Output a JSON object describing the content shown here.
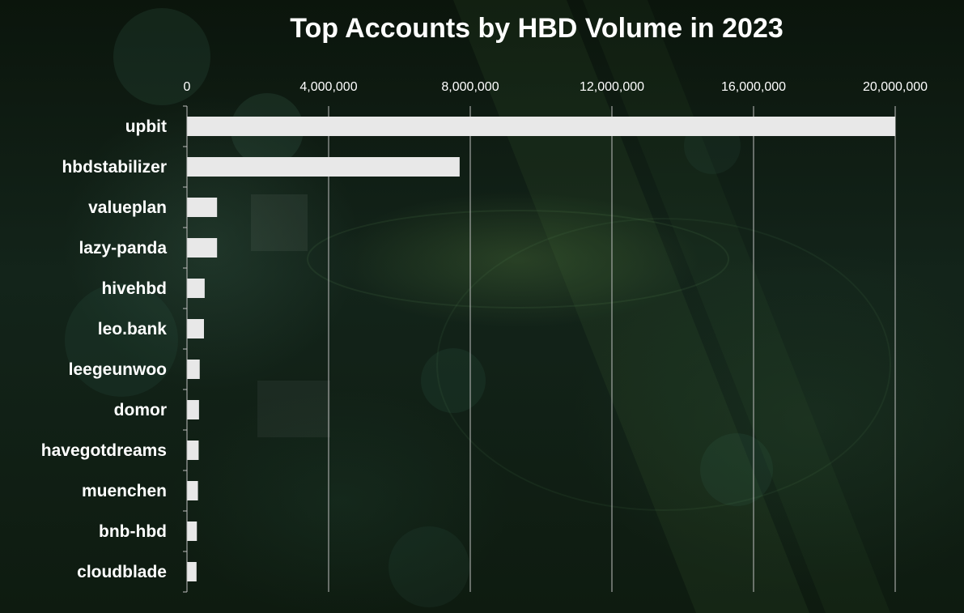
{
  "chart_data": {
    "type": "bar",
    "orientation": "horizontal",
    "title": "Top Accounts by HBD Volume in 2023",
    "xlabel": "",
    "ylabel": "",
    "xlim": [
      0,
      20000000
    ],
    "x_ticks": [
      0,
      4000000,
      8000000,
      12000000,
      16000000,
      20000000
    ],
    "x_tick_labels": [
      "0",
      "4,000,000",
      "8,000,000",
      "12,000,000",
      "16,000,000",
      "20,000,000"
    ],
    "x_axis_position": "top",
    "grid": "vertical",
    "legend": "none",
    "categories": [
      "upbit",
      "hbdstabilizer",
      "valueplan",
      "lazy-panda",
      "hivehbd",
      "leo.bank",
      "leegeunwoo",
      "domor",
      "havegotdreams",
      "muenchen",
      "bnb-hbd",
      "cloudblade"
    ],
    "values": [
      20000000,
      7700000,
      850000,
      850000,
      500000,
      480000,
      360000,
      340000,
      330000,
      310000,
      280000,
      270000
    ]
  },
  "colors": {
    "bar": "#e8e8e8",
    "gridline": "#bfbfbf",
    "text": "#ffffff",
    "background": "#0f1a10"
  }
}
